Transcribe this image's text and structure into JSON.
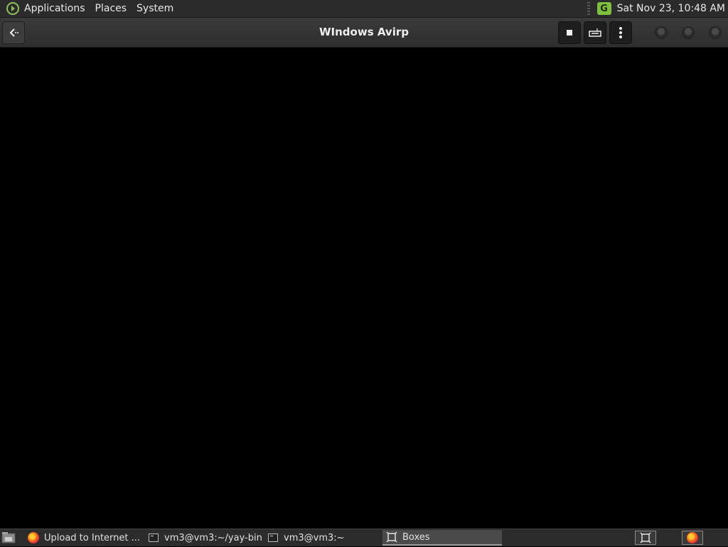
{
  "top_panel": {
    "menus": [
      "Applications",
      "Places",
      "System"
    ],
    "tray_icon_letter": "G",
    "clock": "Sat Nov 23, 10:48 AM"
  },
  "header": {
    "title": "WIndows Avirp"
  },
  "taskbar": {
    "tasks": [
      {
        "label": "Upload to Internet ...",
        "icon": "firefox-icon"
      },
      {
        "label": "vm3@vm3:~/yay-bin",
        "icon": "terminal-icon"
      },
      {
        "label": "vm3@vm3:~",
        "icon": "terminal-icon"
      },
      {
        "label": "Boxes",
        "icon": "boxes-icon",
        "active": true
      }
    ]
  },
  "colors": {
    "panel": "#2b2b2b",
    "header": "#333333",
    "display": "#000000",
    "tray_accent": "#7fbf3f"
  }
}
